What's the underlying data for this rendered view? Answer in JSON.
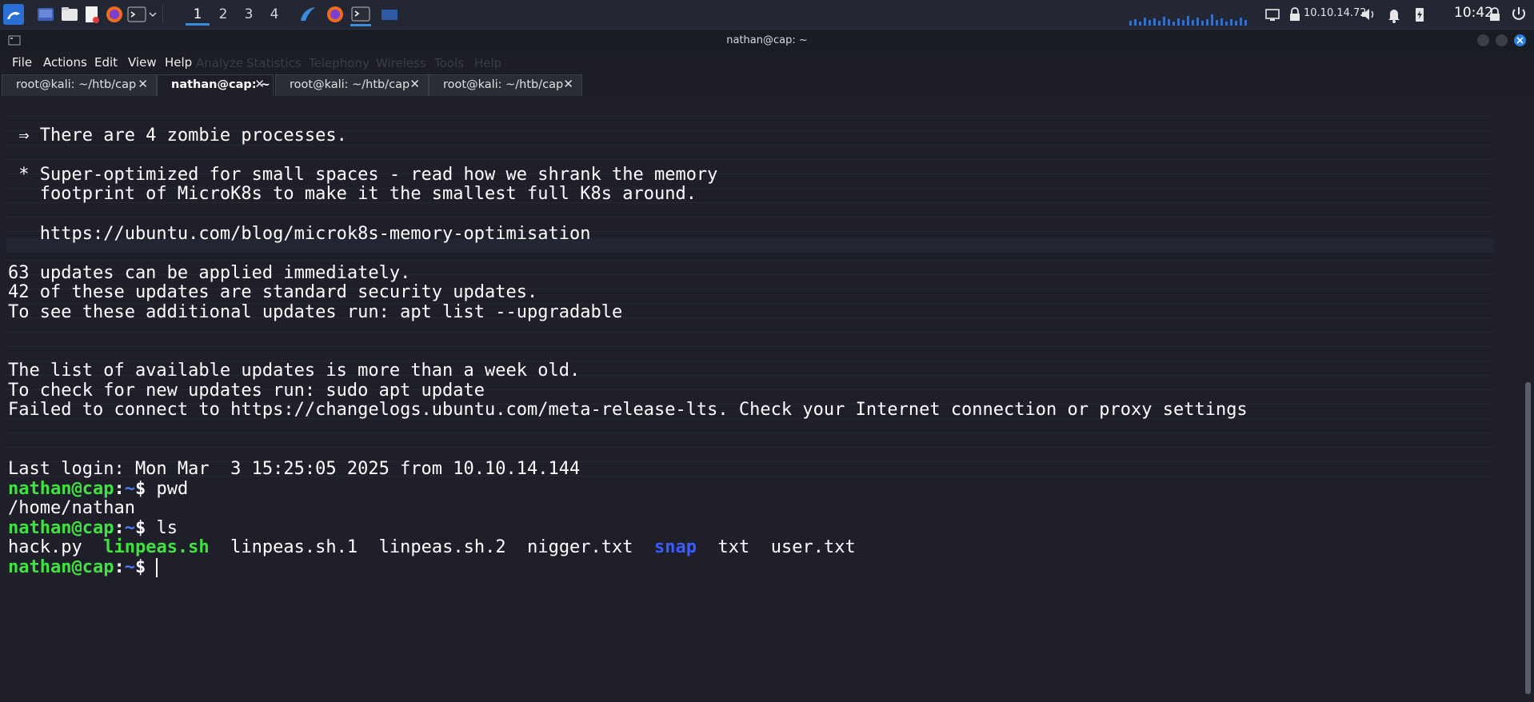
{
  "panel": {
    "workspaces": [
      "1",
      "2",
      "3",
      "4"
    ],
    "active_workspace": "1",
    "tray_ip": "10.10.14.72",
    "clock": "10:42",
    "icons": [
      "kali-menu-icon",
      "desktop-icon",
      "file-manager-icon",
      "text-editor-icon",
      "firefox-icon",
      "terminal-icon",
      "dropdown-icon",
      "kali-dragon-icon",
      "firefox-icon",
      "terminal-icon",
      "window-icon"
    ]
  },
  "window": {
    "title": "nathan@cap: ~"
  },
  "menubar": {
    "items": [
      "File",
      "Actions",
      "Edit",
      "View",
      "Help"
    ],
    "ghost_items": [
      "Analyze",
      "Statistics",
      "Telephony",
      "Wireless",
      "Tools",
      "Help"
    ]
  },
  "tabs": [
    {
      "label": "root@kali: ~/htb/cap",
      "close": "✕"
    },
    {
      "label": "nathan@cap: ~",
      "close": "✕"
    },
    {
      "label": "root@kali: ~/htb/cap",
      "close": "✕"
    },
    {
      "label": "root@kali: ~/htb/cap",
      "close": "✕"
    }
  ],
  "terminal": {
    "lines": [
      " ⇒ There are 4 zombie processes.",
      "",
      " * Super-optimized for small spaces - read how we shrank the memory",
      "   footprint of MicroK8s to make it the smallest full K8s around.",
      "",
      "   https://ubuntu.com/blog/microk8s-memory-optimisation",
      "",
      "63 updates can be applied immediately.",
      "42 of these updates are standard security updates.",
      "To see these additional updates run: apt list --upgradable",
      "",
      "",
      "The list of available updates is more than a week old.",
      "To check for new updates run: sudo apt update",
      "Failed to connect to https://changelogs.ubuntu.com/meta-release-lts. Check your Internet connection or proxy settings",
      "",
      "",
      "Last login: Mon Mar  3 15:25:05 2025 from 10.10.14.144"
    ],
    "prompt": {
      "user": "nathan@cap",
      "colon": ":",
      "path": "~",
      "sign": "$ "
    },
    "cmd1": "pwd",
    "out1": "/home/nathan",
    "cmd2": "ls",
    "ls": [
      {
        "name": "hack.py",
        "kind": "file"
      },
      {
        "name": "linpeas.sh",
        "kind": "exe"
      },
      {
        "name": "linpeas.sh.1",
        "kind": "file"
      },
      {
        "name": "linpeas.sh.2",
        "kind": "file"
      },
      {
        "name": "nigger.txt",
        "kind": "file"
      },
      {
        "name": "snap",
        "kind": "dir"
      },
      {
        "name": "txt",
        "kind": "file"
      },
      {
        "name": "user.txt",
        "kind": "file"
      }
    ]
  }
}
